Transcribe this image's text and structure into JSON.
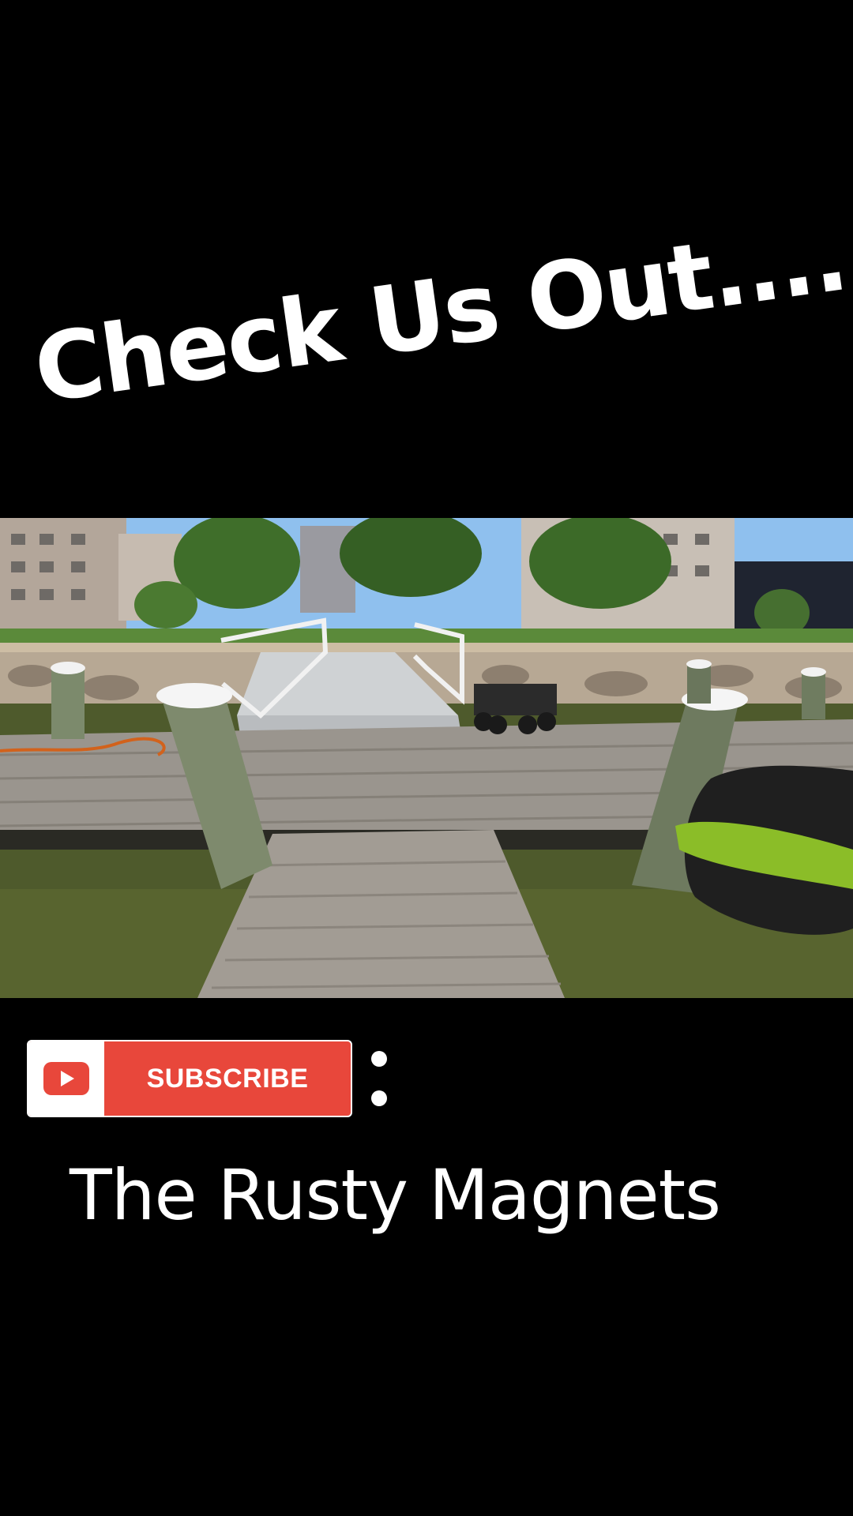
{
  "headline": "Check Us Out....",
  "subscribe": {
    "label": "SUBSCRIBE",
    "button_color": "#e8473b",
    "icon": "youtube-play-icon"
  },
  "menu": {
    "icon": "more-vertical-icon"
  },
  "channel_name": "The Rusty Magnets",
  "video": {
    "scene": "dock-photo"
  }
}
